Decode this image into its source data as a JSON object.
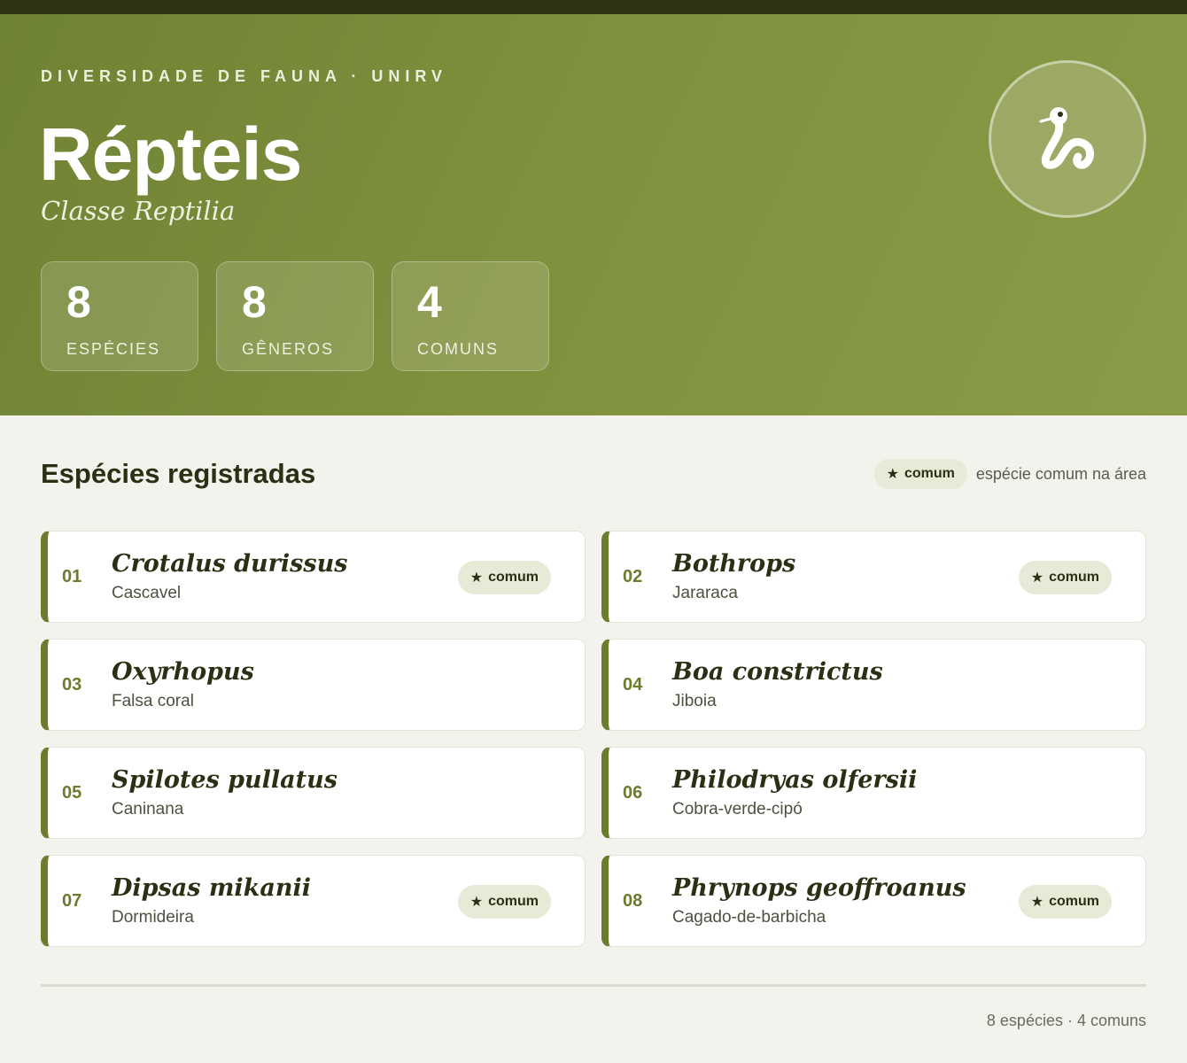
{
  "header": {
    "eyebrow": "DIVERSIDADE DE FAUNA · UNIRV",
    "title": "Répteis",
    "subtitle": "Classe Reptilia",
    "emblem_icon": "snake-icon"
  },
  "stats": [
    {
      "value": "8",
      "label": "ESPÉCIES"
    },
    {
      "value": "8",
      "label": "GÊNEROS"
    },
    {
      "value": "4",
      "label": "COMUNS"
    }
  ],
  "section": {
    "title": "Espécies registradas",
    "legend_badge": "comum",
    "legend_text": "espécie comum na área"
  },
  "species": [
    {
      "num": "01",
      "scientific": "Crotalus durissus",
      "common": "Cascavel",
      "badge": "comum"
    },
    {
      "num": "02",
      "scientific": "Bothrops",
      "common": "Jararaca",
      "badge": "comum"
    },
    {
      "num": "03",
      "scientific": "Oxyrhopus",
      "common": "Falsa coral",
      "badge": ""
    },
    {
      "num": "04",
      "scientific": "Boa constrictus",
      "common": "Jiboia",
      "badge": ""
    },
    {
      "num": "05",
      "scientific": "Spilotes pullatus",
      "common": "Caninana",
      "badge": ""
    },
    {
      "num": "06",
      "scientific": "Philodryas olfersii",
      "common": "Cobra-verde-cipó",
      "badge": ""
    },
    {
      "num": "07",
      "scientific": "Dipsas mikanii",
      "common": "Dormideira",
      "badge": "comum"
    },
    {
      "num": "08",
      "scientific": "Phrynops geoffroanus",
      "common": "Cagado-de-barbicha",
      "badge": "comum"
    }
  ],
  "footer": {
    "summary": "8 espécies · 4 comuns"
  },
  "colors": {
    "accent": "#6b7c2f",
    "hero": "#7f903d",
    "topbar": "#2e3313",
    "background": "#f3f2ec"
  }
}
